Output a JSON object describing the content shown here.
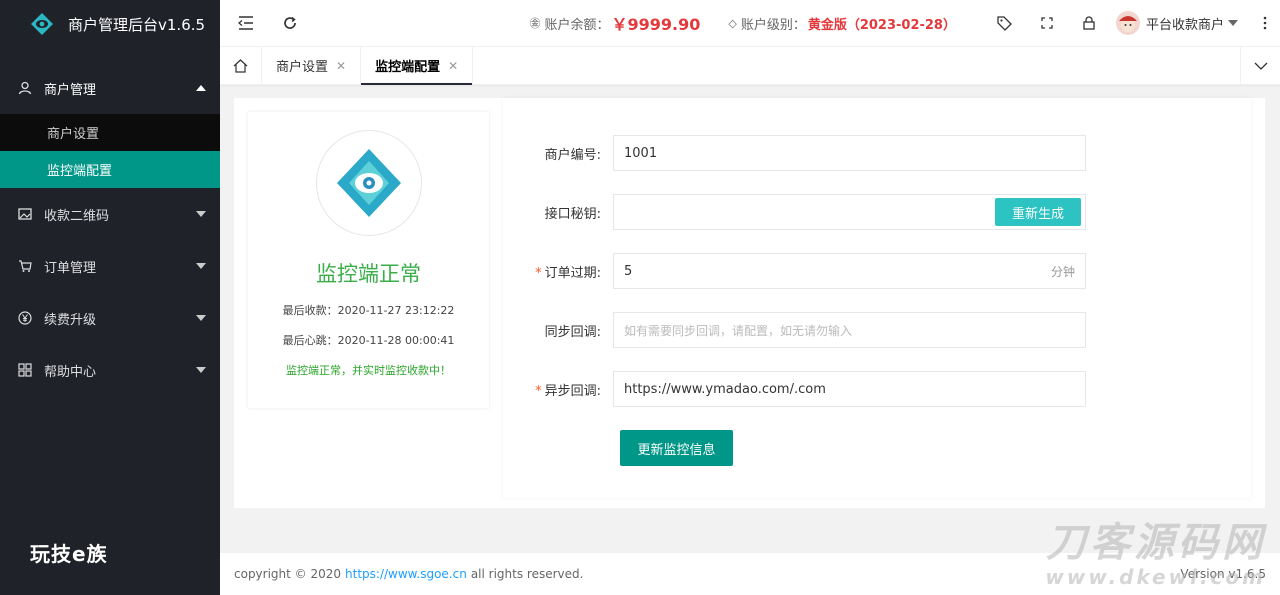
{
  "app": {
    "title": "商户管理后台v1.6.5",
    "brand_footer": "玩技e族"
  },
  "sidebar": {
    "items": [
      {
        "label": "商户管理",
        "icon": "user-icon",
        "open": true,
        "children": [
          {
            "label": "商户设置"
          },
          {
            "label": "监控端配置",
            "active": true
          }
        ]
      },
      {
        "label": "收款二维码",
        "icon": "image-icon"
      },
      {
        "label": "订单管理",
        "icon": "cart-icon"
      },
      {
        "label": "续费升级",
        "icon": "yen-icon"
      },
      {
        "label": "帮助中心",
        "icon": "grid-icon"
      }
    ]
  },
  "header": {
    "balance_label": "账户余额：",
    "balance_value": "￥9999.90",
    "level_label": "账户级别：",
    "level_value": "黄金版（2023-02-28）",
    "username": "平台收款商户"
  },
  "tabs": [
    {
      "label": "商户设置"
    },
    {
      "label": "监控端配置",
      "active": true
    }
  ],
  "status": {
    "title": "监控端正常",
    "last_payment": "最后收款：2020-11-27 23:12:22",
    "last_heartbeat": "最后心跳：2020-11-28 00:00:41",
    "ok_message": "监控端正常，并实时监控收款中！"
  },
  "form": {
    "merchant_id_label": "商户编号:",
    "merchant_id_value": "1001",
    "secret_label": "接口秘钥:",
    "secret_value": "",
    "regen_label": "重新生成",
    "expire_label": "订单过期:",
    "expire_value": "5",
    "expire_suffix": "分钟",
    "sync_label": "同步回调:",
    "sync_placeholder": "如有需要同步回调，请配置，如无请勿输入",
    "async_label": "异步回调:",
    "async_value": "https://www.ymadao.com/.com",
    "submit_label": "更新监控信息"
  },
  "footer": {
    "copyright_prefix": "copyright © 2020",
    "link": "https://www.sgoe.cn",
    "suffix": "all rights reserved.",
    "version": "Version v1.6.5"
  },
  "watermark": {
    "line1": "刀客源码网",
    "line2": "www.dkewl.com"
  },
  "colors": {
    "sidebar_bg": "#20222a",
    "accent": "#009688",
    "danger": "#e4393c",
    "success": "#3aae49",
    "link": "#1e9fff"
  }
}
